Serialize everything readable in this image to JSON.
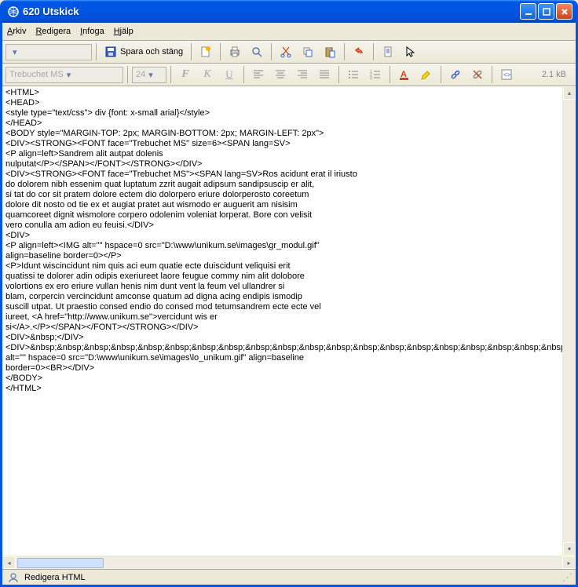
{
  "window": {
    "title": "620 Utskick"
  },
  "menu": {
    "items": [
      "Arkiv",
      "Redigera",
      "Infoga",
      "Hjälp"
    ]
  },
  "toolbar1": {
    "save_close_label": "Spara och stäng"
  },
  "toolbar2": {
    "font_family": "Trebuchet MS",
    "font_size": "24",
    "file_size": "2.1 kB"
  },
  "editor": {
    "lines": [
      "<HTML>",
      "<HEAD>",
      "<style type=\"text/css\"> div {font: x-small arial}</style>",
      "</HEAD>",
      "<BODY style=\"MARGIN-TOP: 2px; MARGIN-BOTTOM: 2px; MARGIN-LEFT: 2px\">",
      "<DIV><STRONG><FONT face=\"Trebuchet MS\" size=6><SPAN lang=SV>",
      "<P align=left>Sandrem alit autpat dolenis",
      "nulputat</P></SPAN></FONT></STRONG></DIV>",
      "<DIV><STRONG><FONT face=\"Trebuchet MS\"><SPAN lang=SV>Ros acidunt erat il iriusto",
      "do dolorem nibh essenim quat luptatum zzrit augait adipsum sandipsuscip er alit,",
      "si tat do cor sit pratem dolore ectem dio dolorpero eriure dolorperosto coreetum",
      "dolore dit nosto od tie ex et augiat pratet aut wismodo er auguerit am nisisim",
      "quamcoreet dignit wismolore corpero odolenim voleniat lorperat. Bore con velisit",
      "vero conulla am adion eu feuisi.</DIV>",
      "<DIV>",
      "<P align=left><IMG alt=\"\" hspace=0 src=\"D:\\www\\unikum.se\\images\\gr_modul.gif\"",
      "align=baseline border=0></P>",
      "<P>Idunt wiscincidunt nim quis aci eum quatie ecte duiscidunt veliquisi erit",
      "quatissi te dolorer adin odipis exeriureet laore feugue commy nim alit dolobore",
      "volortions ex ero eriure vullan henis nim dunt vent la feum vel ullandrer si",
      "blam, corpercin vercincidunt amconse quatum ad digna acing endipis ismodip",
      "suscill utpat. Ut praestio consed endio do consed mod tetumsandrem ecte ecte vel",
      "iureet, <A href=\"http://www.unikum.se\">vercidunt wis er",
      "si</A>.</P></SPAN></FONT></STRONG></DIV>",
      "<DIV>&nbsp;</DIV>",
      "<DIV>&nbsp;&nbsp;&nbsp;&nbsp;&nbsp;&nbsp;&nbsp;&nbsp;&nbsp;&nbsp;&nbsp;&nbsp;&nbsp;&nbsp;&nbsp;&nbsp;&nbsp;&nbsp;&nbsp;&nbsp;<IMG",
      "alt=\"\" hspace=0 src=\"D:\\www\\unikum.se\\images\\lo_unikum.gif\" align=baseline",
      "border=0><BR></DIV>",
      "</BODY>",
      "</HTML>"
    ]
  },
  "statusbar": {
    "label": "Redigera HTML"
  }
}
